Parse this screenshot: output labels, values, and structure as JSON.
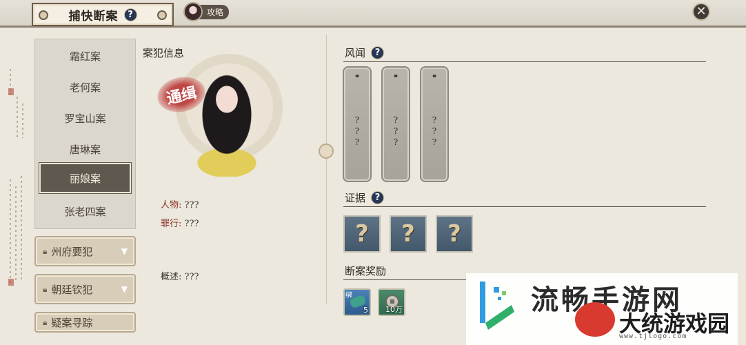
{
  "header": {
    "title": "捕快断案",
    "help_icon": "?",
    "guide_label": "攻略",
    "close_icon": "✕"
  },
  "case_list": {
    "items": [
      {
        "label": "霜红案",
        "active": false
      },
      {
        "label": "老何案",
        "active": false
      },
      {
        "label": "罗宝山案",
        "active": false
      },
      {
        "label": "唐琳案",
        "active": false
      },
      {
        "label": "丽娘案",
        "active": true
      },
      {
        "label": "张老四案",
        "active": false
      }
    ]
  },
  "categories": [
    {
      "label": "州府要犯",
      "locked": true
    },
    {
      "label": "朝廷钦犯",
      "locked": true
    },
    {
      "label": "疑案寻踪",
      "locked": true
    }
  ],
  "criminal_info": {
    "section_title": "案犯信息",
    "stamp_text": "通缉",
    "person_label": "人物:",
    "person_value": "???",
    "crime_label": "罪行:",
    "crime_value": "???",
    "summary_label": "概述:",
    "summary_value": "???"
  },
  "rumors": {
    "section_title": "风闻",
    "help_icon": "?",
    "cards": [
      {
        "text": "?\n?\n?",
        "locked": true
      },
      {
        "text": "?\n?\n?",
        "locked": true
      },
      {
        "text": "?\n?\n?",
        "locked": true
      }
    ]
  },
  "evidence": {
    "section_title": "证据",
    "help_icon": "?",
    "slots": [
      "?",
      "?",
      "?"
    ]
  },
  "rewards": {
    "section_title": "断案奖励",
    "items": [
      {
        "icon": "jade-icon",
        "bound_label": "绑",
        "count": "5"
      },
      {
        "icon": "coin-icon",
        "count": "10万"
      }
    ]
  },
  "watermark": {
    "text1": "流畅手游网",
    "text2": "大统游戏园",
    "url": "www.tjlogo.com"
  }
}
